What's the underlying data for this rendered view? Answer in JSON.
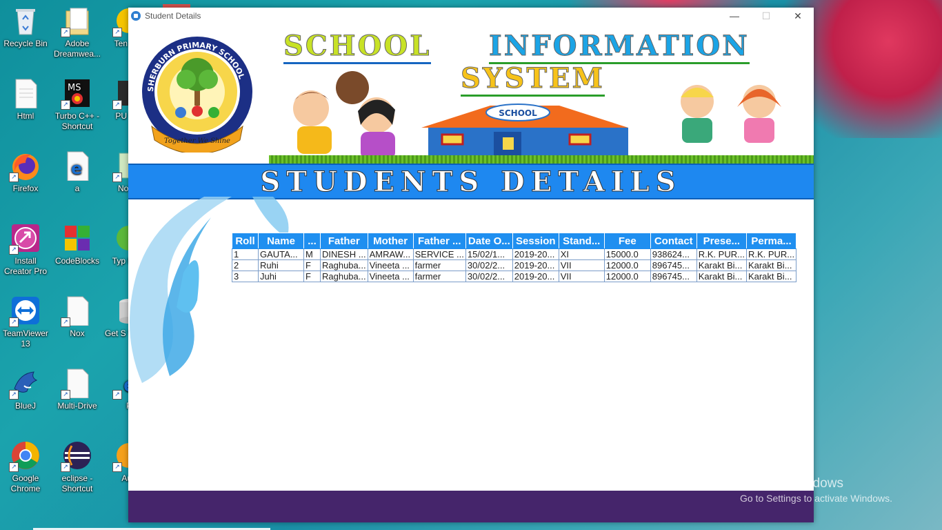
{
  "desktop": {
    "icons": [
      {
        "label": "Recycle Bin"
      },
      {
        "label": "Adobe Dreamwea..."
      },
      {
        "label": "Html"
      },
      {
        "label": "Turbo C++ - Shortcut"
      },
      {
        "label": "Firefox"
      },
      {
        "label": "a"
      },
      {
        "label": "Install Creator Pro"
      },
      {
        "label": "CodeBlocks"
      },
      {
        "label": "TeamViewer 13"
      },
      {
        "label": "Nox"
      },
      {
        "label": "BlueJ"
      },
      {
        "label": "Multi-Drive"
      },
      {
        "label": "Google Chrome"
      },
      {
        "label": "eclipse - Shortcut"
      },
      {
        "label": "Ten Gar"
      },
      {
        "label": "PU MO"
      },
      {
        "label": "Notep"
      },
      {
        "label": "Typ Mast"
      },
      {
        "label": "Get S With C"
      },
      {
        "label": "P"
      },
      {
        "label": "Aud"
      }
    ],
    "activate": {
      "line1": "Activate Windows",
      "line2": "Go to Settings to activate Windows."
    }
  },
  "window": {
    "title": "Student Details",
    "controls": {
      "minimize": "—",
      "maximize": "☐",
      "close": "✕"
    }
  },
  "header": {
    "word1": "SCHOOL",
    "word2": "INFORMATION",
    "word3": "SYSTEM",
    "logo_text": "SHERBURN PRIMARY SCHOOL",
    "logo_motto": "Together We Shine",
    "building_sign": "SCHOOL"
  },
  "banner": {
    "title": "STUDENTS DETAILS"
  },
  "table": {
    "columns": [
      "Roll",
      "Name",
      "...",
      "Father",
      "Mother",
      "Father ...",
      "Date O...",
      "Session",
      "Stand...",
      "Fee",
      "Contact",
      "Prese...",
      "Perma..."
    ],
    "rows": [
      [
        "1",
        "GAUTA...",
        "M",
        "DINESH ...",
        "AMRAW...",
        "SERVICE ...",
        "15/02/1...",
        "2019-20...",
        "XI",
        "15000.0",
        "938624...",
        "R.K. PUR...",
        "R.K. PUR..."
      ],
      [
        "2",
        "Ruhi",
        "F",
        "Raghuba...",
        "Vineeta ...",
        "farmer",
        "30/02/2...",
        "2019-20...",
        "VII",
        "12000.0",
        "896745...",
        "Karakt Bi...",
        "Karakt Bi..."
      ],
      [
        "3",
        "Juhi",
        "F",
        "Raghuba...",
        "Vineeta ...",
        "farmer",
        "30/02/2...",
        "2019-20...",
        "VII",
        "12000.0",
        "896745...",
        "Karakt Bi...",
        "Karakt Bi..."
      ]
    ]
  },
  "colors": {
    "banner": "#1e88f0",
    "footer": "#45256b",
    "header_accent": "#1f8ff0"
  }
}
